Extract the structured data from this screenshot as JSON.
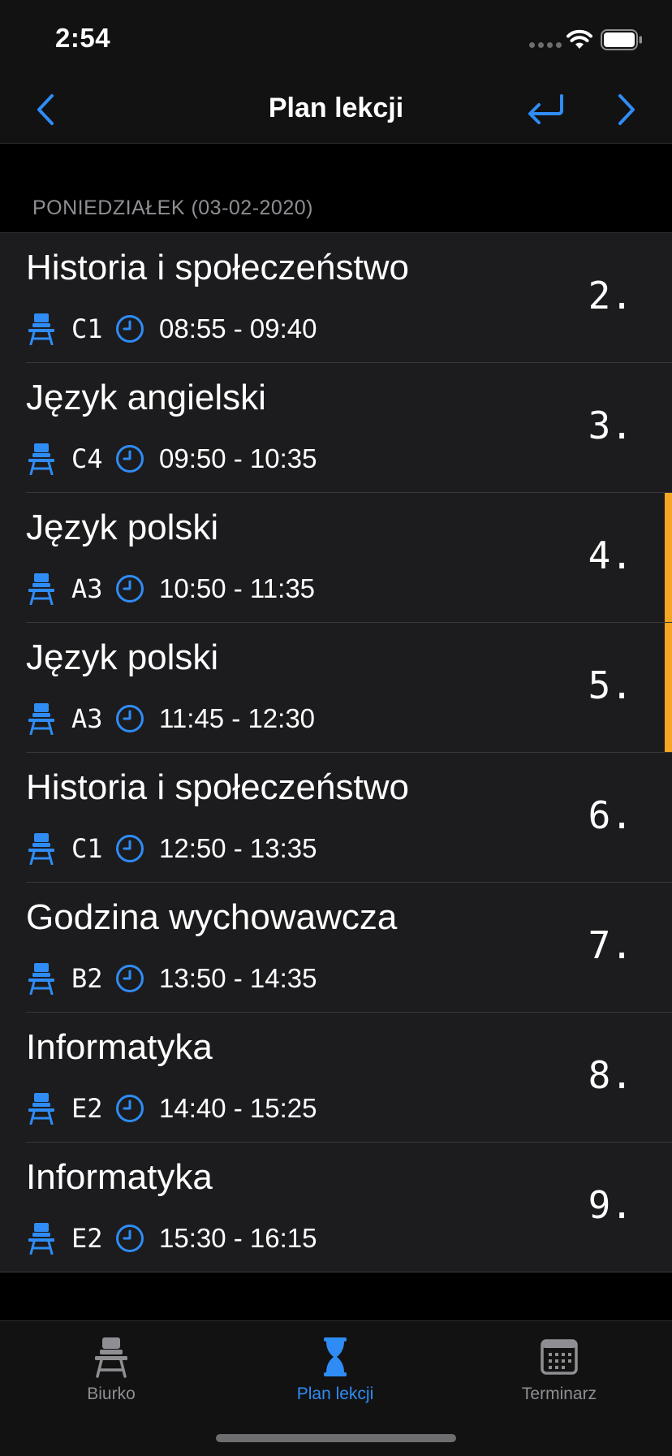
{
  "status_bar": {
    "time": "2:54"
  },
  "nav": {
    "title": "Plan lekcji",
    "back_icon": "chevron-left-icon",
    "today_icon": "return-arrow-icon",
    "forward_icon": "chevron-right-icon"
  },
  "colors": {
    "accent": "#2f8cf5",
    "highlight": "#f5a623"
  },
  "section": {
    "header": "PONIEDZIAŁEK (03-02-2020)"
  },
  "lessons": [
    {
      "subject": "Historia i społeczeństwo",
      "room": "C1",
      "time": "08:55 - 09:40",
      "number": "2.",
      "highlighted": false
    },
    {
      "subject": "Język angielski",
      "room": "C4",
      "time": "09:50 - 10:35",
      "number": "3.",
      "highlighted": false
    },
    {
      "subject": "Język polski",
      "room": "A3",
      "time": "10:50 - 11:35",
      "number": "4.",
      "highlighted": true
    },
    {
      "subject": "Język polski",
      "room": "A3",
      "time": "11:45 - 12:30",
      "number": "5.",
      "highlighted": true
    },
    {
      "subject": "Historia i społeczeństwo",
      "room": "C1",
      "time": "12:50 - 13:35",
      "number": "6.",
      "highlighted": false
    },
    {
      "subject": "Godzina wychowawcza",
      "room": "B2",
      "time": "13:50 - 14:35",
      "number": "7.",
      "highlighted": false
    },
    {
      "subject": "Informatyka",
      "room": "E2",
      "time": "14:40 - 15:25",
      "number": "8.",
      "highlighted": false
    },
    {
      "subject": "Informatyka",
      "room": "E2",
      "time": "15:30 - 16:15",
      "number": "9.",
      "highlighted": false
    }
  ],
  "tabs": [
    {
      "label": "Biurko",
      "icon": "desk-icon",
      "active": false
    },
    {
      "label": "Plan lekcji",
      "icon": "hourglass-icon",
      "active": true
    },
    {
      "label": "Terminarz",
      "icon": "calendar-icon",
      "active": false
    }
  ]
}
